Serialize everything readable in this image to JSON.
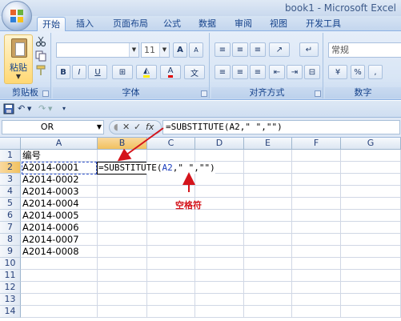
{
  "window": {
    "title": "book1 - Microsoft Excel"
  },
  "tabs": [
    "开始",
    "插入",
    "页面布局",
    "公式",
    "数据",
    "审阅",
    "视图",
    "开发工具"
  ],
  "ribbon": {
    "clipboard": {
      "paste_label": "粘贴",
      "group_label": "剪贴板"
    },
    "font": {
      "size_value": "11",
      "group_label": "字体",
      "grow_label": "A",
      "shrink_label": "A",
      "bold": "B",
      "italic": "I",
      "underline": "U",
      "font_color": "A"
    },
    "alignment": {
      "group_label": "对齐方式"
    },
    "number": {
      "format_value": "常规",
      "group_label": "数字",
      "percent": "%",
      "comma": ","
    }
  },
  "formula_bar": {
    "name_box": "OR",
    "cancel": "✕",
    "enter": "✓",
    "fx": "fx",
    "formula": "=SUBSTITUTE(A2,\" \",\"\")"
  },
  "grid": {
    "columns": [
      "A",
      "B",
      "C",
      "D",
      "E",
      "F",
      "G"
    ],
    "rows": [
      "1",
      "2",
      "3",
      "4",
      "5",
      "6",
      "7",
      "8",
      "9",
      "10",
      "11",
      "12",
      "13",
      "14"
    ],
    "column_a": [
      "编号",
      "A2014-0001",
      "A2014-0002",
      "A2014-0003",
      "A2014-0004",
      "A2014-0005",
      "A2014-0006",
      "A2014-0007",
      "A2014-0008"
    ],
    "editing_cell": {
      "ref": "B2",
      "prefix": "=SUBSTITUTE(",
      "ref_text": "A2",
      "suffix": ",\" \",\"\")"
    }
  },
  "annotation": {
    "text": "空格符",
    "color": "#d4141b"
  },
  "colors": {
    "accent": "#15428b",
    "selected_header": "#f1c15f",
    "annotation_red": "#d4141b"
  }
}
